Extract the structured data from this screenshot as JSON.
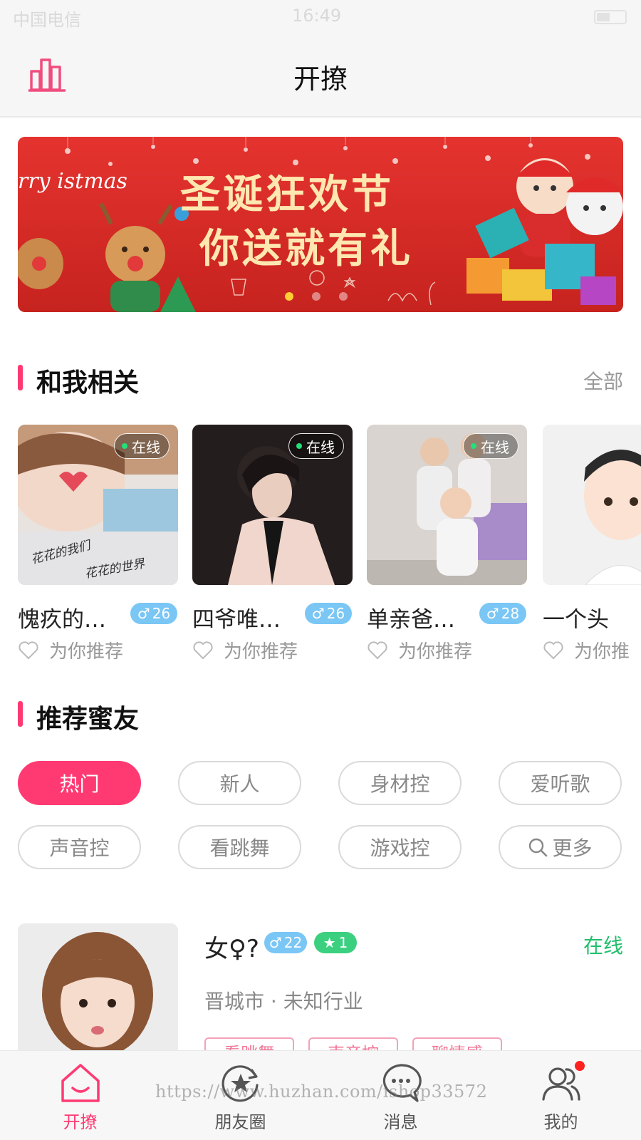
{
  "status_bar": {
    "carrier": "中国电信",
    "time": "16:49"
  },
  "header": {
    "title": "开撩"
  },
  "banner": {
    "script_text": "rry istmas",
    "headline_line1": "圣诞狂欢节",
    "headline_line2": "你送就有礼",
    "active_dot": 0,
    "dot_count": 3
  },
  "related": {
    "title": "和我相关",
    "more": "全部",
    "cards": [
      {
        "name": "愧疚的…",
        "age": "26",
        "online": "在线",
        "rec": "为你推荐",
        "photo_text1": "花花的我们",
        "photo_text2": "花花的世界"
      },
      {
        "name": "四爷唯…",
        "age": "26",
        "online": "在线",
        "rec": "为你推荐"
      },
      {
        "name": "单亲爸…",
        "age": "28",
        "online": "在线",
        "rec": "为你推荐"
      },
      {
        "name": "一个头",
        "age": "",
        "online": "",
        "rec": "为你推"
      }
    ]
  },
  "recommend": {
    "title": "推荐蜜友",
    "tags": [
      "热门",
      "新人",
      "身材控",
      "爱听歌",
      "声音控",
      "看跳舞",
      "游戏控",
      "更多"
    ],
    "active_tag": "热门"
  },
  "user": {
    "name": "女♀?",
    "age": "22",
    "level": "1",
    "status": "在线",
    "info": "晋城市  ·  未知行业",
    "tags": [
      "看跳舞",
      "声音控",
      "聊情感"
    ]
  },
  "tabbar": {
    "items": [
      {
        "label": "开撩",
        "icon": "home-smile-icon",
        "active": true
      },
      {
        "label": "朋友圈",
        "icon": "moments-star-icon",
        "active": false
      },
      {
        "label": "消息",
        "icon": "chat-bubble-icon",
        "active": false
      },
      {
        "label": "我的",
        "icon": "users-icon",
        "active": false
      }
    ]
  },
  "watermark": "https://www.huzhan.com/ishop33572",
  "colors": {
    "accent": "#ff3a73",
    "online_green": "#1fbf6a",
    "age_blue": "#7ac6f5",
    "level_green": "#3bd07f"
  }
}
